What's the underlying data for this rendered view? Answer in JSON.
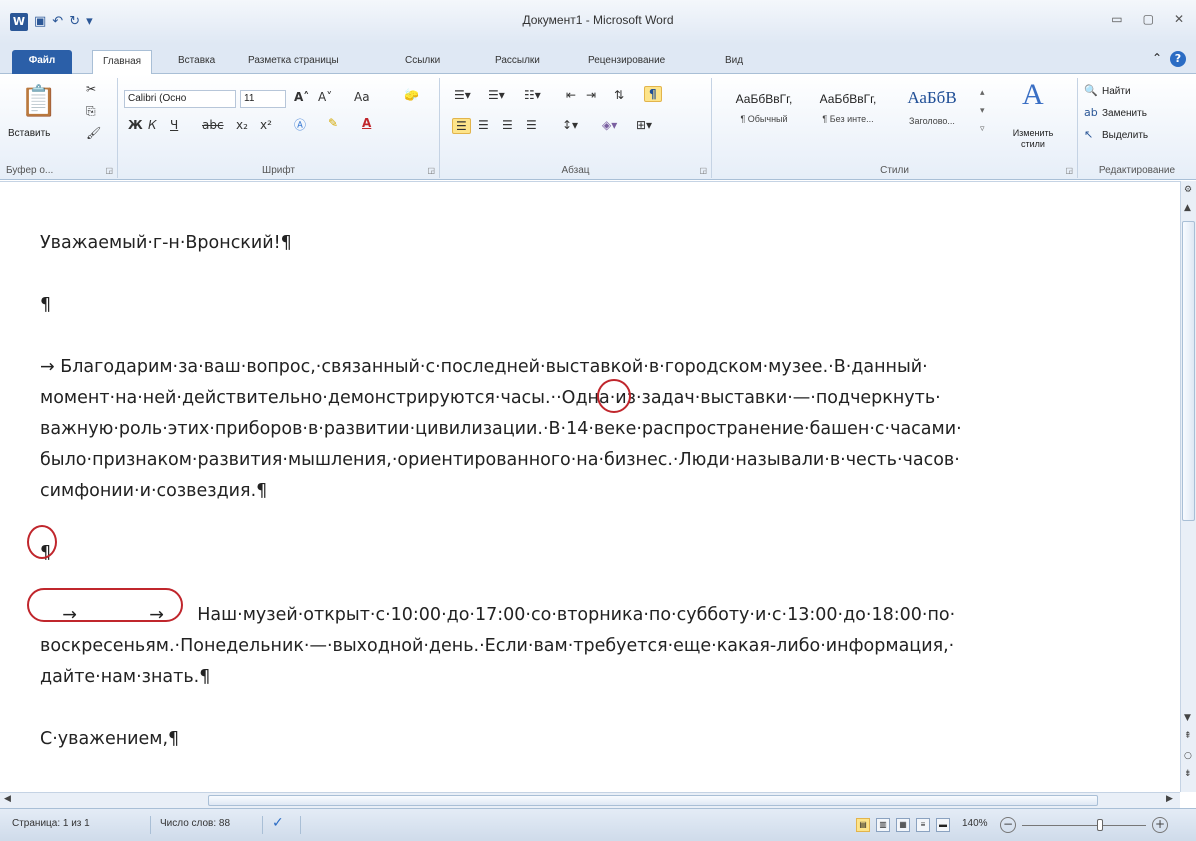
{
  "window": {
    "title": "Документ1 - Microsoft Word",
    "word_icon": "W",
    "controls": [
      "minimize-icon",
      "maximize-icon",
      "close-icon"
    ]
  },
  "tabs": [
    {
      "label": "Файл",
      "type": "file"
    },
    {
      "label": "Главная",
      "active": true
    },
    {
      "label": "Вставка"
    },
    {
      "label": "Разметка страницы"
    },
    {
      "label": "Ссылки"
    },
    {
      "label": "Рассылки"
    },
    {
      "label": "Рецензирование"
    },
    {
      "label": "Вид"
    }
  ],
  "ribbon": {
    "clipboard": {
      "paste_label": "Вставить",
      "group_label": "Буфер о..."
    },
    "font": {
      "font_name": "Calibri (Осно",
      "font_size": "11",
      "group_label": "Шрифт",
      "bold": "Ж",
      "italic": "К",
      "underline": "Ч",
      "strike": "abc",
      "subscript": "x₂",
      "superscript": "x²",
      "grow": "A˄",
      "shrink": "A˅",
      "case": "Aa"
    },
    "paragraph": {
      "group_label": "Абзац",
      "show_marks": "¶"
    },
    "styles": {
      "group_label": "Стили",
      "items": [
        {
          "sample": "АаБбВвГг,",
          "name": "¶ Обычный"
        },
        {
          "sample": "АаБбВвГг,",
          "name": "¶ Без инте..."
        },
        {
          "sample": "АаБбВ",
          "name": "Заголово..."
        }
      ],
      "change_styles": "Изменить стили"
    },
    "editing": {
      "group_label": "Редактирование",
      "find": "Найти",
      "replace": "Заменить",
      "select": "Выделить"
    }
  },
  "document": {
    "greeting": "Уважаемый·г-н·Вронский!¶",
    "empty_mark": "¶",
    "para1_line1": "→  Благодарим·за·ваш·вопрос,·связанный·с·последней·выставкой·в·городском·музее.·В·данный·",
    "para1_line2": "момент·на·ней·действительно·демонстрируются·часы.··Одна·из·задач·выставки·—·подчеркнуть·",
    "para1_line3": "важную·роль·этих·приборов·в·развитии·цивилизации.·В·14·веке·распространение·башен·с·часами·",
    "para1_line4": "было·признаком·развития·мышления,·ориентированного·на·бизнес.·Люди·называли·в·честь·часов·",
    "para1_line5": "симфонии·и·созвездия.¶",
    "empty_mark2": "¶",
    "para2_line1": "    →             →      Наш·музей·открыт·с·10:00·до·17:00·со·вторника·по·субботу·и·с·13:00·до·18:00·по·",
    "para2_line2": "воскресеньям.·Понедельник·—·выходной·день.·Если·вам·требуется·еще·какая-либо·информация,·",
    "para2_line3": "дайте·нам·знать.¶",
    "closing": "С·уважением,¶",
    "empty_mark3": "¶"
  },
  "statusbar": {
    "page": "Страница: 1 из 1",
    "words": "Число слов: 88",
    "zoom": "140%",
    "zoom_level": 0.6
  },
  "colors": {
    "accent": "#2b5797",
    "annotation_circle": "#c0262c",
    "highlight": "#fde48a"
  }
}
